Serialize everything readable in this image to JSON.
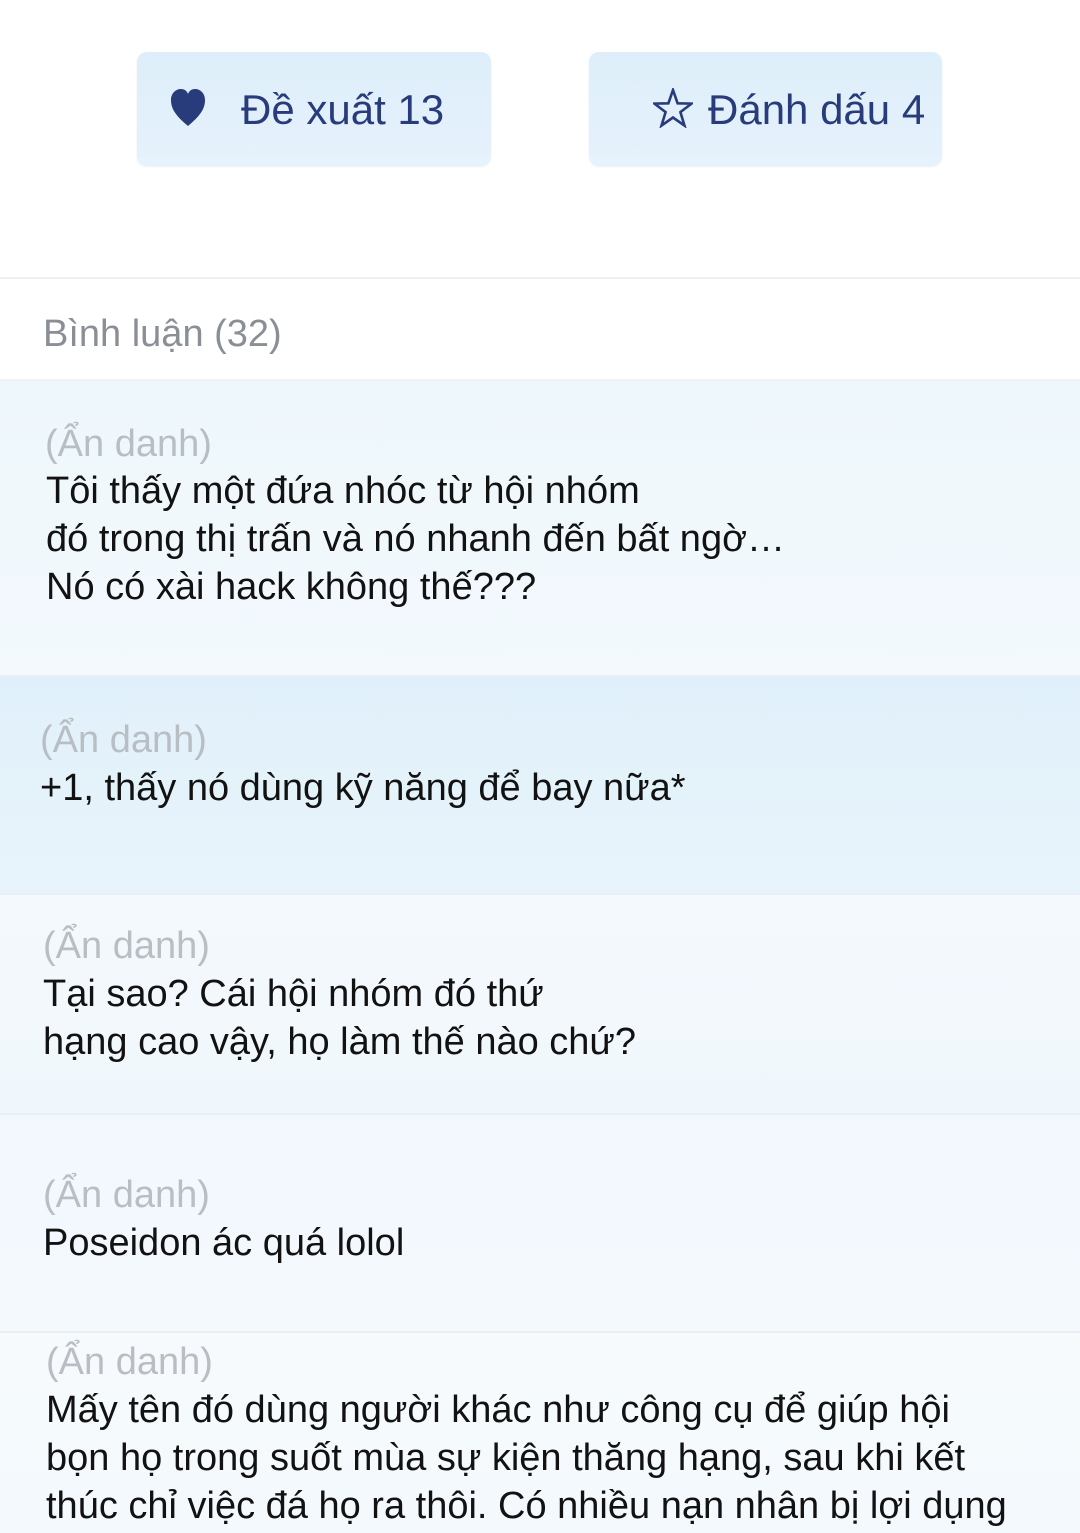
{
  "actions": {
    "recommend_label": "Đề xuất 13",
    "bookmark_label": "Đánh dấu 4",
    "accent_color": "#283b7a",
    "button_bg": "#e1effb"
  },
  "comments": {
    "header": "Bình luận (32)",
    "items": [
      {
        "author": "(Ẩn danh)",
        "lines": [
          "Tôi thấy một đứa nhóc từ hội nhóm",
          "đó trong thị trấn và nó nhanh đến bất ngờ…",
          "Nó có xài hack không thế???"
        ]
      },
      {
        "author": "(Ẩn danh)",
        "lines": [
          "+1, thấy nó dùng kỹ năng để bay nữa*"
        ]
      },
      {
        "author": "(Ẩn danh)",
        "lines": [
          "Tại sao? Cái hội nhóm đó thứ",
          "hạng cao vậy, họ làm thế nào chứ?"
        ]
      },
      {
        "author": "(Ẩn danh)",
        "lines": [
          "Poseidon ác quá lolol"
        ]
      },
      {
        "author": "(Ẩn danh)",
        "lines": [
          "Mấy tên đó dùng người khác như công cụ để giúp hội",
          "bọn họ trong suốt mùa sự kiện thăng hạng, sau khi kết",
          "thúc chỉ việc đá họ ra thôi. Có nhiều nạn nhân bị lợi dụng"
        ]
      }
    ]
  }
}
